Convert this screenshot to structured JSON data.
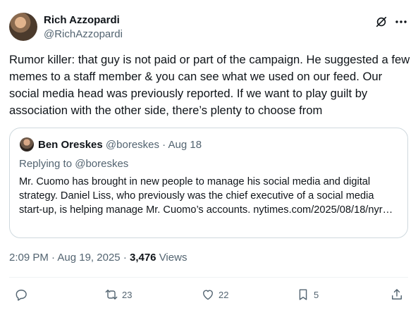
{
  "author": {
    "name": "Rich Azzopardi",
    "handle": "@RichAzzopardi"
  },
  "icons": {
    "header": [
      "grok-icon",
      "more-icon"
    ],
    "actions": [
      "reply-icon",
      "retweet-icon",
      "like-icon",
      "bookmark-icon",
      "share-icon"
    ]
  },
  "tweet": {
    "text": "Rumor killer: that guy is not paid or part of the campaign. He suggested a few memes to a staff member & you can see what we used on our feed. Our social media head was previously reported. If we want to play guilt by association with the other side, there’s plenty to choose from"
  },
  "quote": {
    "name": "Ben Oreskes",
    "handle": "@boreskes",
    "separator": "·",
    "date": "Aug 18",
    "replying_prefix": "Replying to",
    "replying_to": "@boreskes",
    "text": "Mr. Cuomo has brought in new people to manage his social media and digital strategy. Daniel Liss, who previously was the chief executive of a social media start-up, is helping manage Mr. Cuomo’s accounts. nytimes.com/2025/08/18/nyr…"
  },
  "meta": {
    "time": "2:09 PM",
    "sep1": "·",
    "date": "Aug 19, 2025",
    "sep2": "·",
    "views_count": "3,476",
    "views_label": "Views"
  },
  "actions": {
    "retweets": "23",
    "likes": "22",
    "bookmarks": "5"
  },
  "colors": {
    "text": "#0f1419",
    "secondary": "#536471",
    "border": "#cfd9de"
  }
}
